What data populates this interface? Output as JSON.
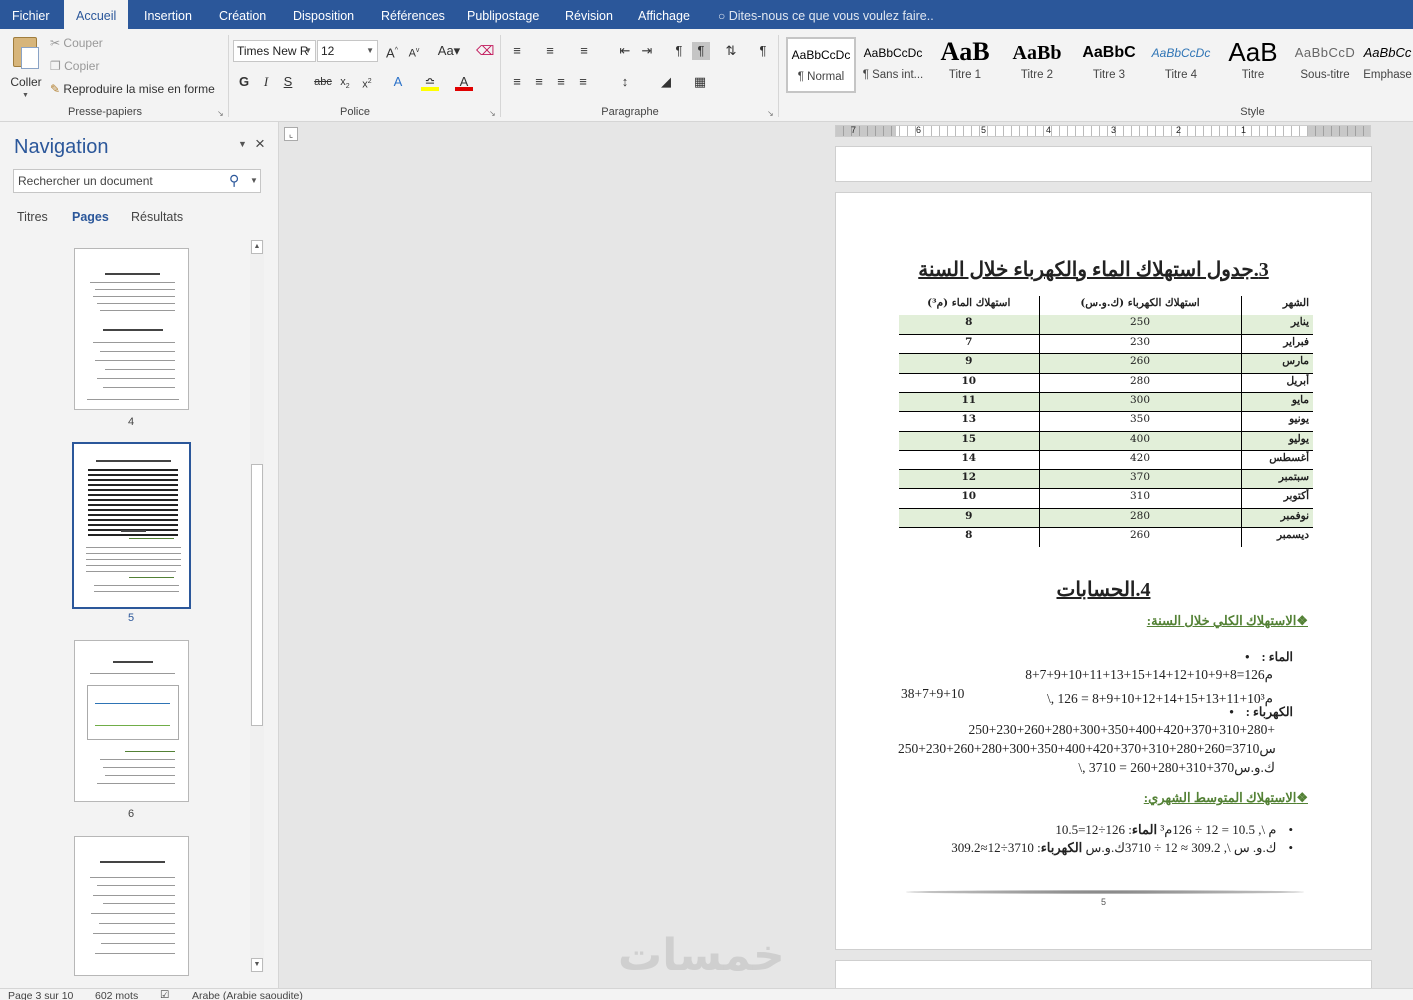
{
  "menu": {
    "tabs": [
      "Fichier",
      "Accueil",
      "Insertion",
      "Création",
      "Disposition",
      "Références",
      "Publipostage",
      "Révision",
      "Affichage"
    ],
    "tell_me": "Dites-nous ce que vous voulez faire.."
  },
  "ribbon": {
    "clipboard": {
      "paste": "Coller",
      "cut": "Couper",
      "copy": "Copier",
      "format_painter": "Reproduire la mise en forme",
      "label": "Presse-papiers"
    },
    "font": {
      "name": "Times New R",
      "size": "12",
      "label": "Police"
    },
    "paragraph": {
      "label": "Paragraphe"
    },
    "styles": {
      "label": "Style",
      "items": [
        {
          "preview": "AaBbCcDc",
          "name": "¶ Normal"
        },
        {
          "preview": "AaBbCcDc",
          "name": "¶ Sans int..."
        },
        {
          "preview": "AaB",
          "name": "Titre 1"
        },
        {
          "preview": "AaBb",
          "name": "Titre 2"
        },
        {
          "preview": "AaBbC",
          "name": "Titre 3"
        },
        {
          "preview": "AaBbCcDc",
          "name": "Titre 4"
        },
        {
          "preview": "AaB",
          "name": "Titre"
        },
        {
          "preview": "AaBbCcD",
          "name": "Sous-titre"
        },
        {
          "preview": "AaBbCc",
          "name": "Emphase"
        }
      ]
    }
  },
  "navigation": {
    "title": "Navigation",
    "search_placeholder": "Rechercher un document",
    "tabs": [
      "Titres",
      "Pages",
      "Résultats"
    ],
    "pages": [
      "4",
      "5",
      "6"
    ]
  },
  "ruler": {
    "numbers": [
      "7",
      "6",
      "5",
      "4",
      "3",
      "2",
      "1"
    ]
  },
  "document": {
    "table_heading": "3.جدول استهلاك الماء والكهرباء خلال السنة",
    "table_headers": [
      "الشهر",
      "استهلاك الكهرباء (ك.و.س)",
      "استهلاك الماء (م³)"
    ],
    "rows": [
      [
        "يناير",
        "250",
        "8"
      ],
      [
        "فبراير",
        "230",
        "7"
      ],
      [
        "مارس",
        "260",
        "9"
      ],
      [
        "أبريل",
        "280",
        "10"
      ],
      [
        "مايو",
        "300",
        "11"
      ],
      [
        "يونيو",
        "350",
        "13"
      ],
      [
        "يوليو",
        "400",
        "15"
      ],
      [
        "أغسطس",
        "420",
        "14"
      ],
      [
        "سبتمبر",
        "370",
        "12"
      ],
      [
        "أكتوبر",
        "310",
        "10"
      ],
      [
        "نوفمبر",
        "280",
        "9"
      ],
      [
        "ديسمبر",
        "260",
        "8"
      ]
    ],
    "calc_heading": "4.الحسابات",
    "total_heading": "الاستهلاك الكلي خلال السنة:",
    "water_label": "الماء :",
    "water_line1": "8+7+9+10+11+13+15+14+12+10+9+8=126م",
    "water_line1_b": "38+7+9+10",
    "water_line2": "\\, 126 = 8+9+10+12+14+15+13+11+10م³",
    "elec_label": "الكهرباء :",
    "elec_line1": "250+230+260+280+300+350+400+420+370+310+280+",
    "elec_line2": "250+230+260+280+300+350+400+420+370+310+280+260=3710ك.و.س",
    "elec_line3": "\\, 3710 = 260+280+310+370ك.و.س",
    "avg_heading": "الاستهلاك المتوسط الشهري:",
    "avg_water_label": "الماء",
    "avg_water": "10.5=12÷126 :م \\, 10.5 = 12 ÷ 126م³",
    "avg_elec_label": "الكهرباء",
    "avg_elec": "309.2≈12÷3710 :ك.و. س \\, 309.2 ≈ 12 ÷ 3710ك.و.س",
    "page_number": "5"
  },
  "watermark": "خمسات",
  "status": {
    "page": "Page 3 sur 10",
    "words": "602 mots",
    "language": "Arabe (Arabie saoudite)"
  },
  "colors": {
    "brand": "#2b579a",
    "heading_green": "#538135",
    "table_shade": "#e2efd9"
  }
}
